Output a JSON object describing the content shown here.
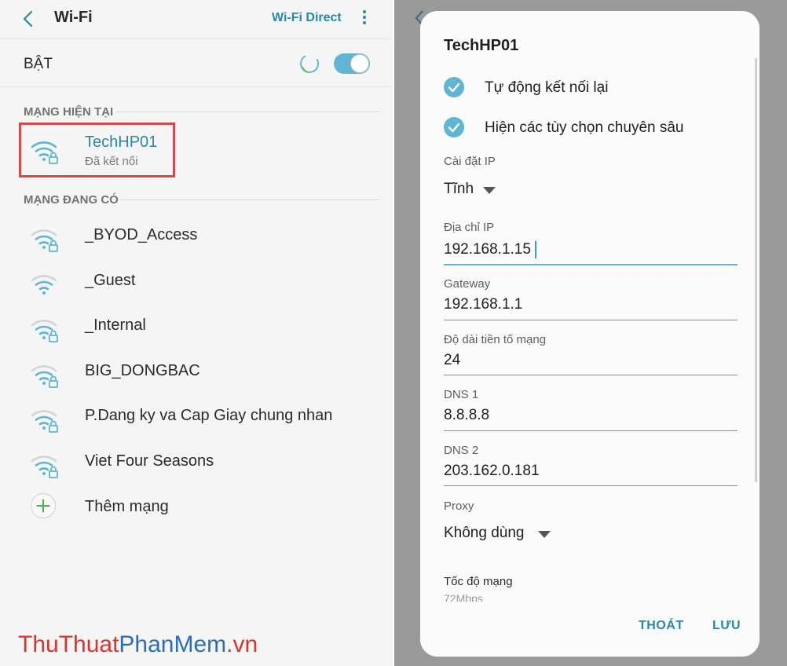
{
  "left": {
    "title": "Wi-Fi",
    "wifi_direct": "Wi-Fi Direct",
    "toggle_label": "BẬT",
    "toggle_on": true,
    "current_section": "MẠNG HIỆN TẠI",
    "current_network": {
      "name": "TechHP01",
      "status": "Đã kết nối"
    },
    "available_section": "MẠNG ĐANG CÓ",
    "networks": [
      {
        "name": "_BYOD_Access",
        "locked": true
      },
      {
        "name": "_Guest",
        "locked": false
      },
      {
        "name": "_Internal",
        "locked": true
      },
      {
        "name": "BIG_DONGBAC",
        "locked": true
      },
      {
        "name": "P.Dang ky va Cap Giay chung nhan",
        "locked": true
      },
      {
        "name": "Viet Four Seasons",
        "locked": true
      }
    ],
    "add_network": "Thêm mạng"
  },
  "watermark": {
    "thu": "Thu",
    "thuat": "Thuat",
    "phan": "Phan",
    "mem": "Mem",
    "vn": ".vn"
  },
  "dialog": {
    "title": "TechHP01",
    "auto_reconnect": "Tự động kết nối lại",
    "advanced_options": "Hiện các tùy chọn chuyên sâu",
    "ip_settings_label": "Cài đặt IP",
    "ip_settings_value": "Tĩnh",
    "ip_label": "Địa chỉ IP",
    "ip_value": "192.168.1.15",
    "gateway_label": "Gateway",
    "gateway_value": "192.168.1.1",
    "prefix_label": "Độ dài tiền tố mạng",
    "prefix_value": "24",
    "dns1_label": "DNS 1",
    "dns1_value": "8.8.8.8",
    "dns2_label": "DNS 2",
    "dns2_value": "203.162.0.181",
    "proxy_label": "Proxy",
    "proxy_value": "Không dùng",
    "speed_label": "Tốc độ mạng",
    "speed_value": "72Mbps",
    "cancel": "THOÁT",
    "save": "LƯU"
  },
  "colors": {
    "accent": "#5fb5d3",
    "link": "#2a86a6",
    "highlight_border": "#d64a4a",
    "watermark_red": "#d9342b",
    "watermark_blue": "#2a6fb8"
  },
  "icons": {
    "back": "back-arrow-icon",
    "more": "more-vert-icon",
    "wifi": "wifi-icon",
    "lock": "lock-icon",
    "add": "plus-icon",
    "check": "check-icon",
    "dropdown": "dropdown-triangle-icon",
    "spinner": "loading-spinner-icon"
  }
}
